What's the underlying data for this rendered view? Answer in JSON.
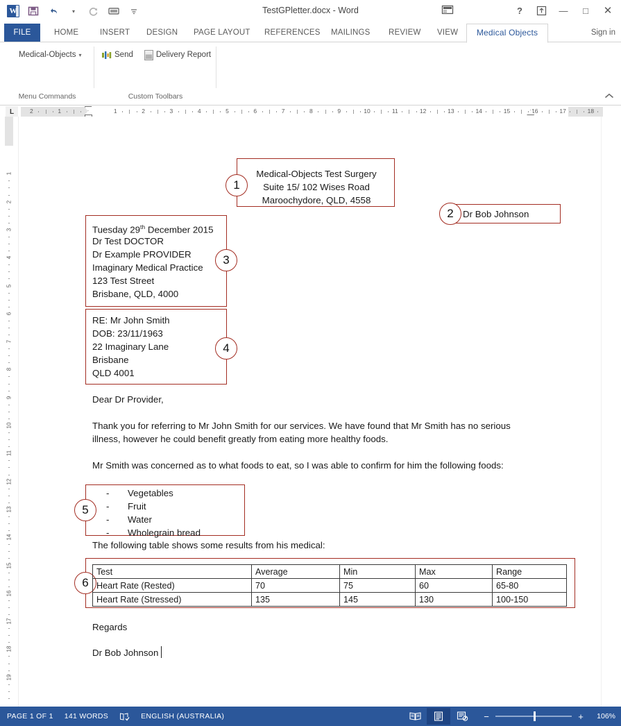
{
  "window": {
    "title": "TestGPletter.docx - Word",
    "app_icon": "word-icon",
    "quick_access": [
      {
        "name": "save-icon",
        "label": "Save"
      },
      {
        "name": "undo-icon",
        "label": "Undo"
      },
      {
        "name": "redo-icon",
        "label": "Repeat"
      },
      {
        "name": "touch-mode-icon",
        "label": "Touch/Mouse Mode"
      },
      {
        "name": "customize-qat-icon",
        "label": "Customize Quick Access Toolbar"
      }
    ],
    "controls": {
      "help": "?",
      "ribbon_display": "ribbon-display-options-icon",
      "minimize": "—",
      "maximize": "□",
      "close": "✕"
    },
    "sign_in": "Sign in",
    "account_icon": "account-icon"
  },
  "ribbon": {
    "tabs": [
      {
        "label": "FILE",
        "state": "file"
      },
      {
        "label": "HOME",
        "state": "normal"
      },
      {
        "label": "INSERT",
        "state": "normal"
      },
      {
        "label": "DESIGN",
        "state": "normal"
      },
      {
        "label": "PAGE LAYOUT",
        "state": "normal"
      },
      {
        "label": "REFERENCES",
        "state": "normal"
      },
      {
        "label": "MAILINGS",
        "state": "normal"
      },
      {
        "label": "REVIEW",
        "state": "normal"
      },
      {
        "label": "VIEW",
        "state": "normal"
      },
      {
        "label": "Medical Objects",
        "state": "active"
      }
    ],
    "groups": [
      {
        "label": "Menu Commands",
        "items": [
          {
            "label": "Medical-Objects",
            "icon": "dropdown-caret-icon",
            "has_caret": true
          }
        ]
      },
      {
        "label": "Custom Toolbars",
        "items": [
          {
            "label": "Send",
            "icon": "send-icon",
            "has_caret": false
          },
          {
            "label": "Delivery Report",
            "icon": "delivery-report-icon",
            "has_caret": false
          }
        ]
      }
    ],
    "collapse_icon": "collapse-ribbon-icon"
  },
  "ruler": {
    "tab_selector": "L",
    "horizontal_numbers": [
      "2",
      "1",
      "1",
      "2",
      "3",
      "4",
      "5",
      "6",
      "7",
      "8",
      "9",
      "10",
      "11",
      "12",
      "13",
      "14",
      "15",
      "17",
      "18"
    ],
    "vertical_numbers": [
      "1",
      "1",
      "2",
      "3",
      "4",
      "5",
      "6",
      "7",
      "8",
      "9",
      "10",
      "11",
      "12",
      "13",
      "14",
      "15",
      "16",
      "17",
      "18",
      "9"
    ]
  },
  "document": {
    "annotations": [
      {
        "number": "1",
        "target": "sender-address-block"
      },
      {
        "number": "2",
        "target": "sender-name-block"
      },
      {
        "number": "3",
        "target": "recipient-block"
      },
      {
        "number": "4",
        "target": "patient-block"
      },
      {
        "number": "5",
        "target": "foods-list-block"
      },
      {
        "number": "6",
        "target": "results-table-block"
      }
    ],
    "sender_address": [
      "Medical-Objects Test Surgery",
      "Suite 15/ 102 Wises Road",
      "Maroochydore, QLD, 4558"
    ],
    "sender_name": "Dr Bob Johnson",
    "recipient": [
      "Tuesday 29th December 2015",
      "Dr Test DOCTOR",
      "Dr Example PROVIDER",
      "Imaginary Medical Practice",
      "123 Test Street",
      "Brisbane, QLD, 4000"
    ],
    "recipient_date_prefix": "Tuesday 29",
    "recipient_date_sup": "th",
    "recipient_date_suffix": " December 2015",
    "patient": [
      "RE: Mr John Smith",
      "DOB: 23/11/1963",
      "22 Imaginary Lane",
      "Brisbane",
      "QLD 4001"
    ],
    "salutation": "Dear Dr Provider,",
    "paragraph_1": "Thank you for referring to Mr John Smith for our services. We have found that Mr Smith has no serious illness, however he could benefit greatly from eating more healthy foods.",
    "paragraph_2": "Mr Smith was concerned as to what foods to eat, so I was able to confirm for him the following foods:",
    "foods": [
      "Vegetables",
      "Fruit",
      "Water",
      "Wholegrain bread"
    ],
    "foods_bullet": "-",
    "table_intro": "The following table shows some results from his medical:",
    "table": {
      "headers": [
        "Test",
        "Average",
        "Min",
        "Max",
        "Range"
      ],
      "rows": [
        [
          "Heart Rate (Rested)",
          "70",
          "75",
          "60",
          "65-80"
        ],
        [
          "Heart Rate (Stressed)",
          "135",
          "145",
          "130",
          "100-150"
        ]
      ]
    },
    "closing": "Regards",
    "signature": "Dr Bob Johnson"
  },
  "status_bar": {
    "page": "PAGE 1 OF 1",
    "words": "141 WORDS",
    "proofing_icon": "proofing-errors-icon",
    "language": "ENGLISH (AUSTRALIA)",
    "views": [
      {
        "name": "read-mode-icon",
        "selected": false
      },
      {
        "name": "print-layout-icon",
        "selected": true
      },
      {
        "name": "web-layout-icon",
        "selected": false
      }
    ],
    "zoom_out": "−",
    "zoom_in": "+",
    "zoom_level": "106%"
  },
  "colors": {
    "accent": "#2b579a",
    "annotation": "#a32d22",
    "status_bar": "#2b579a",
    "text": "#1a1a1a"
  }
}
